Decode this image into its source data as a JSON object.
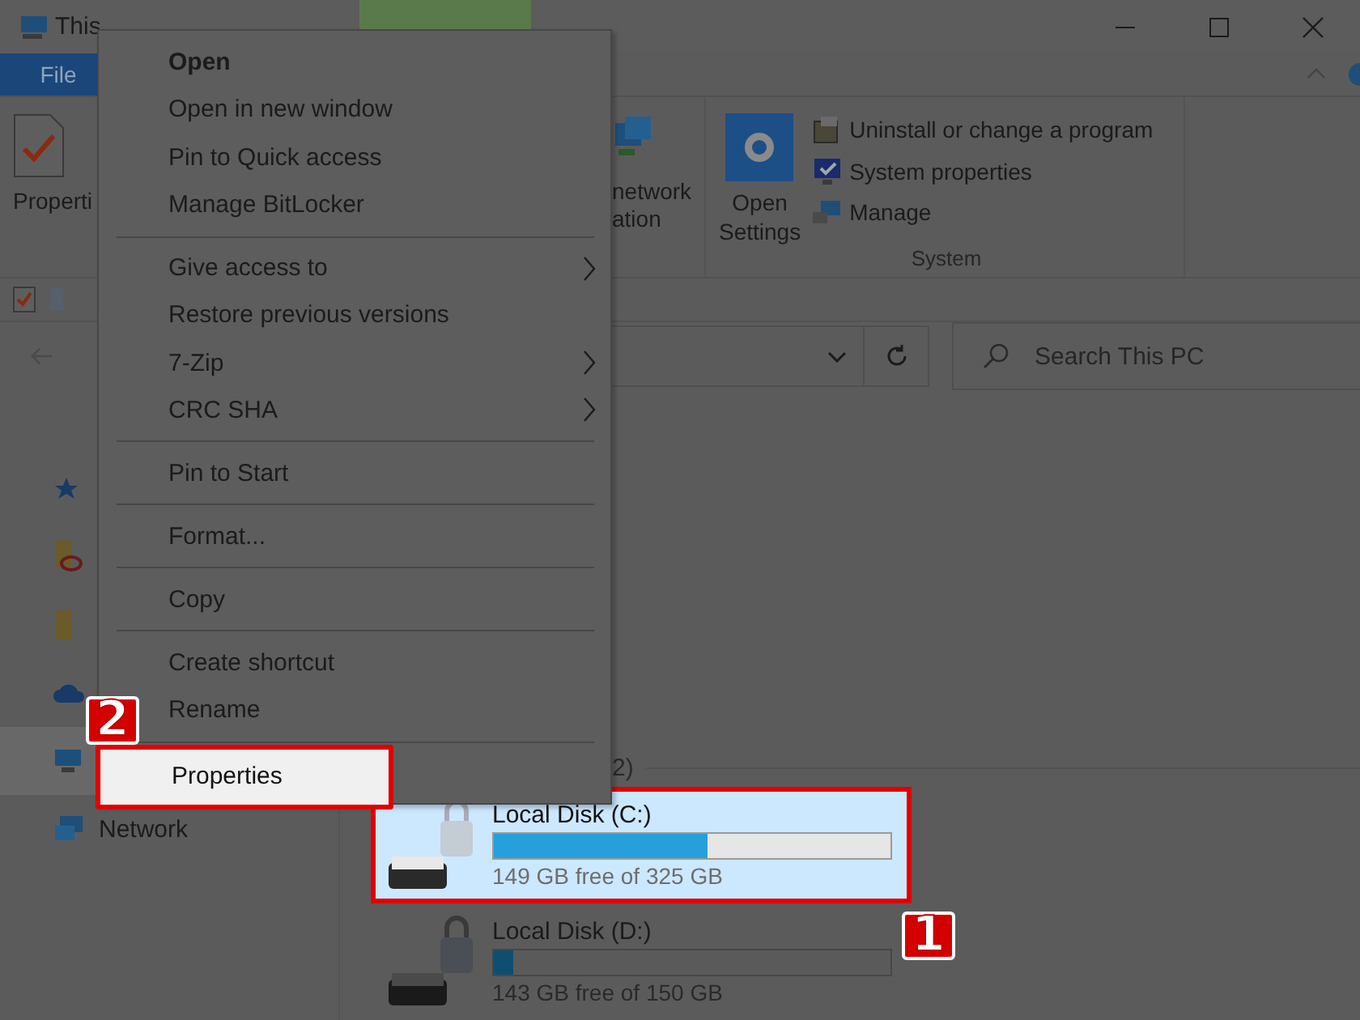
{
  "window": {
    "title": "This"
  },
  "ribbon": {
    "tabs": [
      {
        "label": "File",
        "selected": true
      }
    ],
    "properties_button": "Properti",
    "network_button": {
      "line_1": "network",
      "line_2": "ation"
    },
    "system_group": {
      "label": "System",
      "open_settings": {
        "line_1": "Open",
        "line_2": "Settings"
      },
      "commands": [
        {
          "kind": "uninstall",
          "label": "Uninstall or change a program"
        },
        {
          "kind": "system-properties",
          "label": "System properties"
        },
        {
          "kind": "manage",
          "label": "Manage"
        }
      ]
    }
  },
  "search": {
    "placeholder": "Search This PC"
  },
  "sidebar": {
    "items": [
      {
        "kind": "star",
        "selected": false
      },
      {
        "kind": "folder-badge",
        "selected": false
      },
      {
        "kind": "folder",
        "selected": false
      },
      {
        "kind": "cloud",
        "selected": false
      },
      {
        "kind": "pc",
        "selected": true
      },
      {
        "kind": "network",
        "label": "Network",
        "selected": false
      }
    ]
  },
  "content": {
    "group_header": "2)",
    "drives": [
      {
        "name": "Local Disk (C:)",
        "level": 0.54,
        "reading": "149 GB free of 325 GB",
        "selected": true
      },
      {
        "name": "Local Disk (D:)",
        "level": 0.05,
        "reading": "143 GB free of 150 GB",
        "selected": false
      }
    ]
  },
  "context_menu": {
    "items": [
      {
        "kind": "item",
        "label": "Open",
        "default": true,
        "submenu": false,
        "selected": false
      },
      {
        "kind": "item",
        "label": "Open in new window",
        "default": false,
        "submenu": false,
        "selected": false
      },
      {
        "kind": "item",
        "label": "Pin to Quick access",
        "default": false,
        "submenu": false,
        "selected": false
      },
      {
        "kind": "item",
        "label": "Manage BitLocker",
        "default": false,
        "submenu": false,
        "selected": false
      },
      {
        "kind": "separator"
      },
      {
        "kind": "item",
        "label": "Give access to",
        "default": false,
        "submenu": true,
        "selected": false
      },
      {
        "kind": "item",
        "label": "Restore previous versions",
        "default": false,
        "submenu": false,
        "selected": false
      },
      {
        "kind": "item",
        "label": "7-Zip",
        "default": false,
        "submenu": true,
        "selected": false
      },
      {
        "kind": "item",
        "label": "CRC SHA",
        "default": false,
        "submenu": true,
        "selected": false
      },
      {
        "kind": "separator"
      },
      {
        "kind": "item",
        "label": "Pin to Start",
        "default": false,
        "submenu": false,
        "selected": false
      },
      {
        "kind": "separator"
      },
      {
        "kind": "item",
        "label": "Format...",
        "default": false,
        "submenu": false,
        "selected": false
      },
      {
        "kind": "separator"
      },
      {
        "kind": "item",
        "label": "Copy",
        "default": false,
        "submenu": false,
        "selected": false
      },
      {
        "kind": "separator"
      },
      {
        "kind": "item",
        "label": "Create shortcut",
        "default": false,
        "submenu": false,
        "selected": false
      },
      {
        "kind": "item",
        "label": "Rename",
        "default": false,
        "submenu": false,
        "selected": false
      },
      {
        "kind": "separator"
      },
      {
        "kind": "item",
        "label": "Properties",
        "default": false,
        "submenu": false,
        "selected": true
      }
    ]
  },
  "annotations": [
    {
      "label": "1"
    },
    {
      "label": "2"
    }
  ]
}
